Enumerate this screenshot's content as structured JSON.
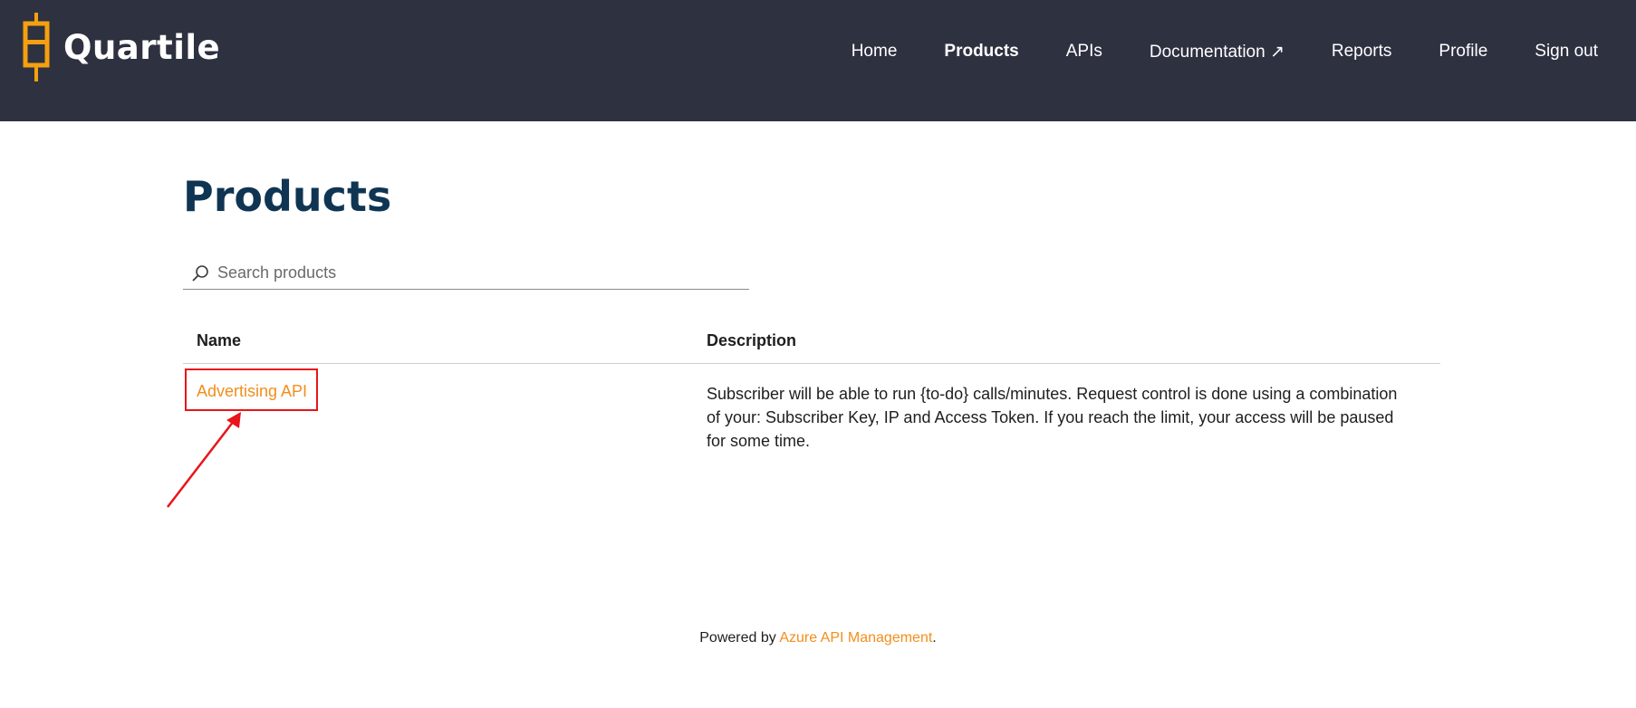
{
  "brand": {
    "name": "Quartile",
    "accent": "#f5a011",
    "header_bg": "#2e3140"
  },
  "nav": [
    {
      "label": "Home"
    },
    {
      "label": "Products"
    },
    {
      "label": "APIs"
    },
    {
      "label": "Documentation ↗"
    },
    {
      "label": "Reports"
    },
    {
      "label": "Profile"
    },
    {
      "label": "Sign out"
    }
  ],
  "page": {
    "title": "Products"
  },
  "search": {
    "placeholder": "Search products",
    "value": ""
  },
  "table": {
    "columns": {
      "name": "Name",
      "description": "Description"
    },
    "rows": [
      {
        "name": "Advertising API",
        "description": "Subscriber will be able to run {to-do} calls/minutes. Request control is done using a combination of your: Subscriber Key, IP and Access Token. If you reach the limit, your access will be paused for some time."
      }
    ]
  },
  "footer": {
    "prefix": "Powered by ",
    "link": "Azure API Management",
    "suffix": "."
  },
  "annotation": {
    "highlight_color": "#e8141a"
  }
}
